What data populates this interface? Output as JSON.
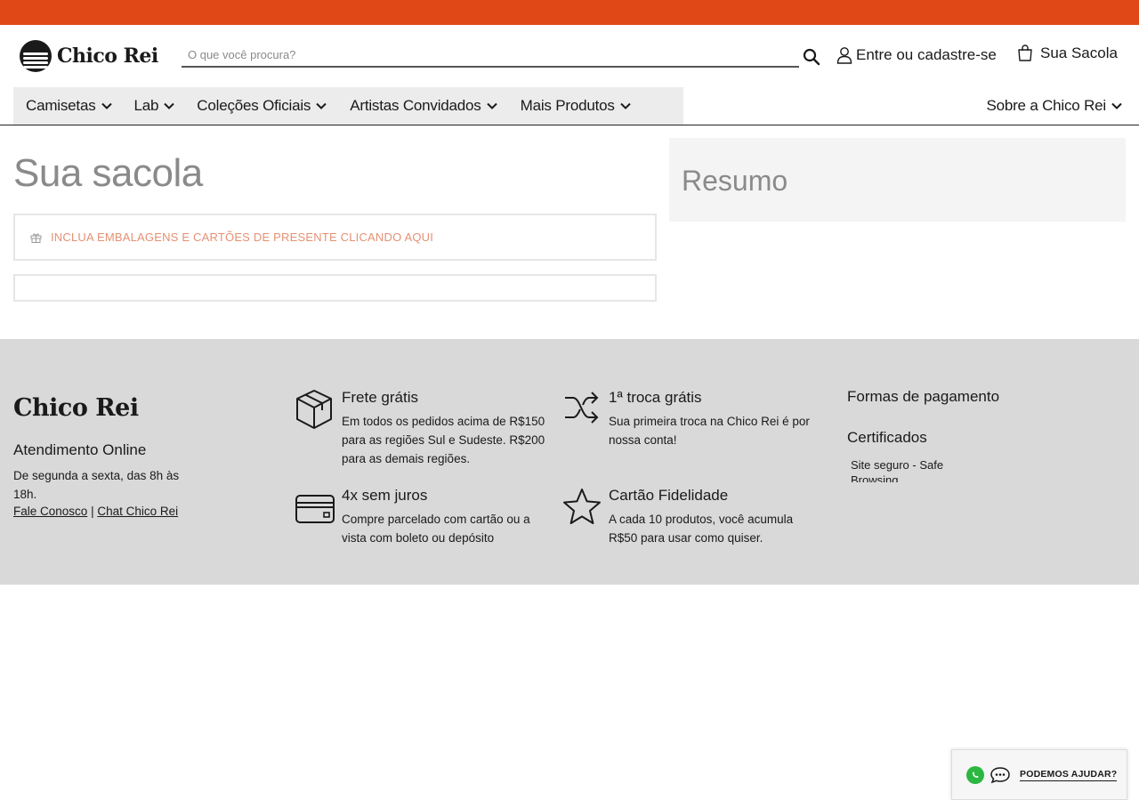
{
  "colors": {
    "topbar": "#e04818",
    "nav_bg": "#ececec",
    "footer_bg": "#d9d9d9",
    "gift_text": "#e59173",
    "title_gray": "#8a8a8a",
    "whatsapp": "#2bb741"
  },
  "header": {
    "logo_text": "Chico Rei",
    "search_placeholder": "O que você procura?",
    "account_label": "Entre ou cadastre-se",
    "bag_label": "Sua Sacola",
    "icons": [
      "search-icon",
      "user-icon",
      "shopping-bag-icon"
    ]
  },
  "nav": {
    "items": [
      {
        "label": "Camisetas"
      },
      {
        "label": "Lab"
      },
      {
        "label": "Coleções Oficiais"
      },
      {
        "label": "Artistas Convidados"
      },
      {
        "label": "Mais Produtos"
      }
    ],
    "right_item": {
      "label": "Sobre a Chico Rei"
    }
  },
  "cart": {
    "title": "Sua sacola",
    "gift_wrap_label": "INCLUA EMBALAGENS E CARTÕES DE PRESENTE CLICANDO AQUI"
  },
  "summary": {
    "title": "Resumo"
  },
  "footer": {
    "logo_text": "Chico Rei",
    "support_title": "Atendimento Online",
    "support_hours": "De segunda a sexta, das 8h às 18h.",
    "link_contact": "Fale Conosco",
    "link_separator": "|",
    "link_chat": "Chat Chico Rei",
    "features": [
      {
        "icon": "box-icon",
        "title": "Frete grátis",
        "text": "Em todos os pedidos acima de R$150 para as regiões Sul e Sudeste. R$200 para as demais regiões."
      },
      {
        "icon": "shuffle-icon",
        "title": "1ª troca grátis",
        "text": "Sua primeira troca na Chico Rei é por nossa conta!"
      },
      {
        "icon": "credit-card-icon",
        "title": "4x sem juros",
        "text": "Compre parcelado com cartão ou a vista com boleto ou depósito"
      },
      {
        "icon": "star-icon",
        "title": "Cartão Fidelidade",
        "text": "A cada 10 produtos, você acumula R$50 para usar como quiser."
      }
    ],
    "payment_title": "Formas de pagamento",
    "cert_title": "Certificados",
    "cert_item": "Site seguro - Safe Browsing"
  },
  "help_widget": {
    "label": "PODEMOS AJUDAR?",
    "icons": [
      "whatsapp-icon",
      "chat-bubble-icon"
    ]
  }
}
